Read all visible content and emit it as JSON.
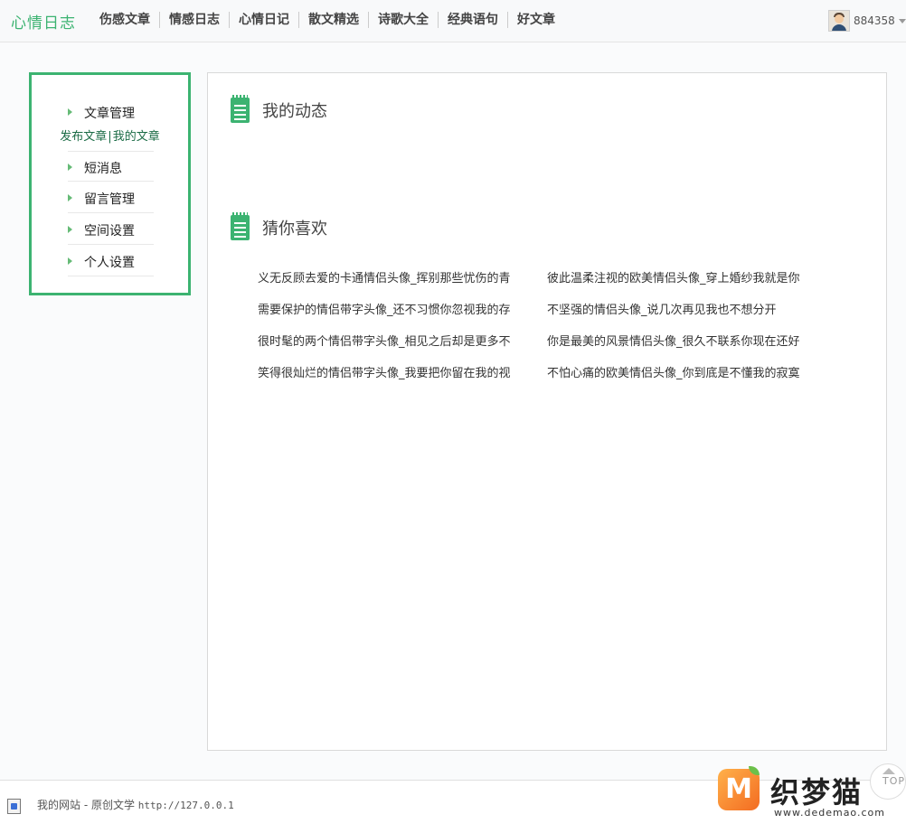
{
  "header": {
    "logo": "心情日志",
    "nav": [
      "伤感文章",
      "情感日志",
      "心情日记",
      "散文精选",
      "诗歌大全",
      "经典语句",
      "好文章"
    ],
    "username": "884358"
  },
  "sidebar": {
    "items": [
      "文章管理",
      "短消息",
      "留言管理",
      "空间设置",
      "个人设置"
    ],
    "sublinks": [
      "发布文章",
      "我的文章"
    ],
    "sublink_sep": "|"
  },
  "main": {
    "activity_title": "我的动态",
    "guess_title": "猜你喜欢",
    "guess_items": [
      "义无反顾去爱的卡通情侣头像_挥别那些忧伤的青",
      "彼此温柔注视的欧美情侣头像_穿上婚纱我就是你",
      "需要保护的情侣带字头像_还不习惯你忽视我的存",
      "不坚强的情侣头像_说几次再见我也不想分开",
      "很时髦的两个情侣带字头像_相见之后却是更多不",
      "你是最美的风景情侣头像_很久不联系你现在还好",
      "笑得很灿烂的情侣带字头像_我要把你留在我的视",
      "不怕心痛的欧美情侣头像_你到底是不懂我的寂寞"
    ]
  },
  "footer": {
    "site": "我的网站 - 原创文学",
    "url": "http://127.0.0.1"
  },
  "top_button": "TOP",
  "watermark": {
    "logo_letter": "M",
    "name": "织梦猫",
    "url": "www.dedemao.com"
  },
  "colors": {
    "accent": "#3cb371",
    "sublink": "#1a6b45"
  }
}
